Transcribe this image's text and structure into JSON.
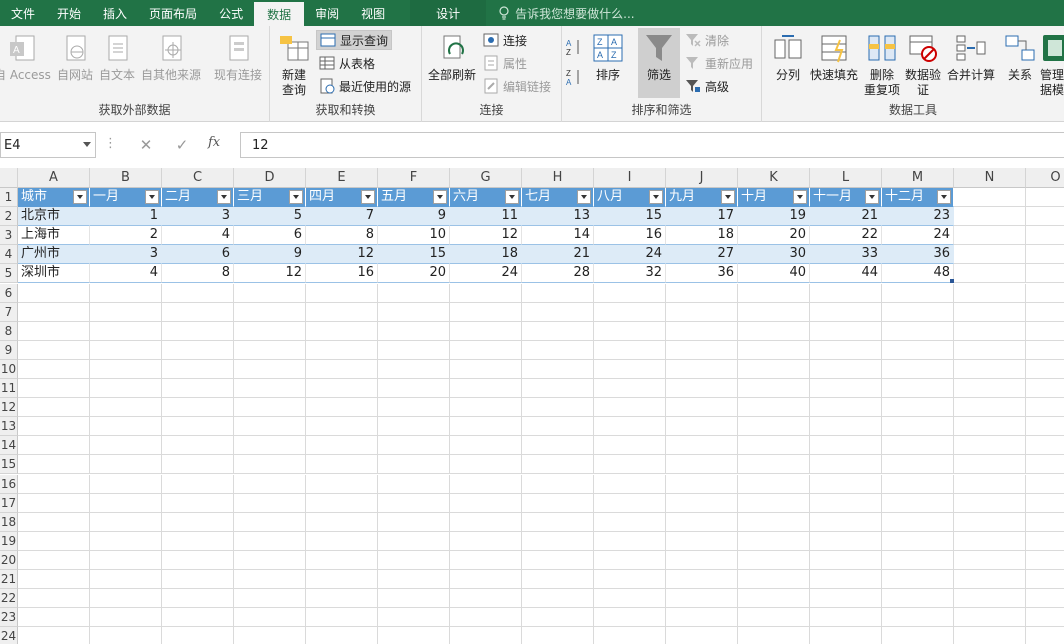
{
  "ribbon_tabs": [
    {
      "label": "文件",
      "active": false
    },
    {
      "label": "开始",
      "active": false
    },
    {
      "label": "插入",
      "active": false
    },
    {
      "label": "页面布局",
      "active": false
    },
    {
      "label": "公式",
      "active": false
    },
    {
      "label": "数据",
      "active": true
    },
    {
      "label": "审阅",
      "active": false
    },
    {
      "label": "视图",
      "active": false
    },
    {
      "label": "设计",
      "active": false
    }
  ],
  "tell_me": "告诉我您想要做什么...",
  "groups": {
    "get_external": {
      "label": "获取外部数据",
      "buttons": [
        "自 Access",
        "自网站",
        "自文本",
        "自其他来源",
        "现有连接"
      ]
    },
    "get_transform": {
      "label": "获取和转换",
      "new_query_line1": "新建",
      "new_query_line2": "查询",
      "show_query": "显示查询",
      "from_table": "从表格",
      "recent_sources": "最近使用的源"
    },
    "connections": {
      "label": "连接",
      "refresh_all": "全部刷新",
      "connections": "连接",
      "properties": "属性",
      "edit_links": "编辑链接"
    },
    "sort_filter": {
      "label": "排序和筛选",
      "sort": "排序",
      "filter": "筛选",
      "clear": "清除",
      "reapply": "重新应用",
      "advanced": "高级"
    },
    "data_tools": {
      "label": "数据工具",
      "text_to_columns": "分列",
      "flash_fill": "快速填充",
      "remove_dup_line1": "删除",
      "remove_dup_line2": "重复项",
      "validation_line1": "数据验",
      "validation_line2": "证",
      "consolidate": "合并计算",
      "relationships": "关系",
      "manage_line1": "管理",
      "manage_line2": "据模"
    }
  },
  "formula_bar": {
    "name_box": "E4",
    "fx": "fx",
    "formula": "12"
  },
  "columns": [
    "A",
    "B",
    "C",
    "D",
    "E",
    "F",
    "G",
    "H",
    "I",
    "J",
    "K",
    "L",
    "M",
    "N",
    "O"
  ],
  "row_numbers": [
    "1",
    "2",
    "3",
    "4",
    "5",
    "6",
    "7",
    "8",
    "9",
    "10",
    "11",
    "12",
    "13",
    "14",
    "15",
    "16",
    "17",
    "18",
    "19",
    "20",
    "21",
    "22",
    "23",
    "24"
  ],
  "table": {
    "headers": [
      "城市",
      "一月",
      "二月",
      "三月",
      "四月",
      "五月",
      "六月",
      "七月",
      "八月",
      "九月",
      "十月",
      "十一月",
      "十二月"
    ],
    "rows": [
      {
        "city": "北京市",
        "values": [
          "1",
          "3",
          "5",
          "7",
          "9",
          "11",
          "13",
          "15",
          "17",
          "19",
          "21",
          "23"
        ]
      },
      {
        "city": "上海市",
        "values": [
          "2",
          "4",
          "6",
          "8",
          "10",
          "12",
          "14",
          "16",
          "18",
          "20",
          "22",
          "24"
        ]
      },
      {
        "city": "广州市",
        "values": [
          "3",
          "6",
          "9",
          "12",
          "15",
          "18",
          "21",
          "24",
          "27",
          "30",
          "33",
          "36"
        ]
      },
      {
        "city": "深圳市",
        "values": [
          "4",
          "8",
          "12",
          "16",
          "20",
          "24",
          "28",
          "32",
          "36",
          "40",
          "44",
          "48"
        ]
      }
    ]
  },
  "colors": {
    "brand": "#217346",
    "table_header": "#5b9bd5",
    "table_band": "#ddebf7"
  }
}
